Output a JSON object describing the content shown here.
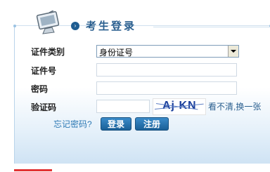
{
  "header": {
    "title": "考生登录",
    "bullet": "›"
  },
  "form": {
    "id_type_label": "证件类别",
    "id_type_value": "身份证号",
    "id_number_label": "证件号",
    "id_number_value": "",
    "password_label": "密码",
    "password_value": "",
    "captcha_label": "验证码",
    "captcha_value": "",
    "captcha_image_text": "Aj KN",
    "refresh_link": "看不清,换一张",
    "forgot_link": "忘记密码?",
    "login_button": "登录",
    "register_button": "注册"
  },
  "colors": {
    "title": "#2a5f8f",
    "button": "#1a5f96",
    "link": "#2e7ab5"
  }
}
